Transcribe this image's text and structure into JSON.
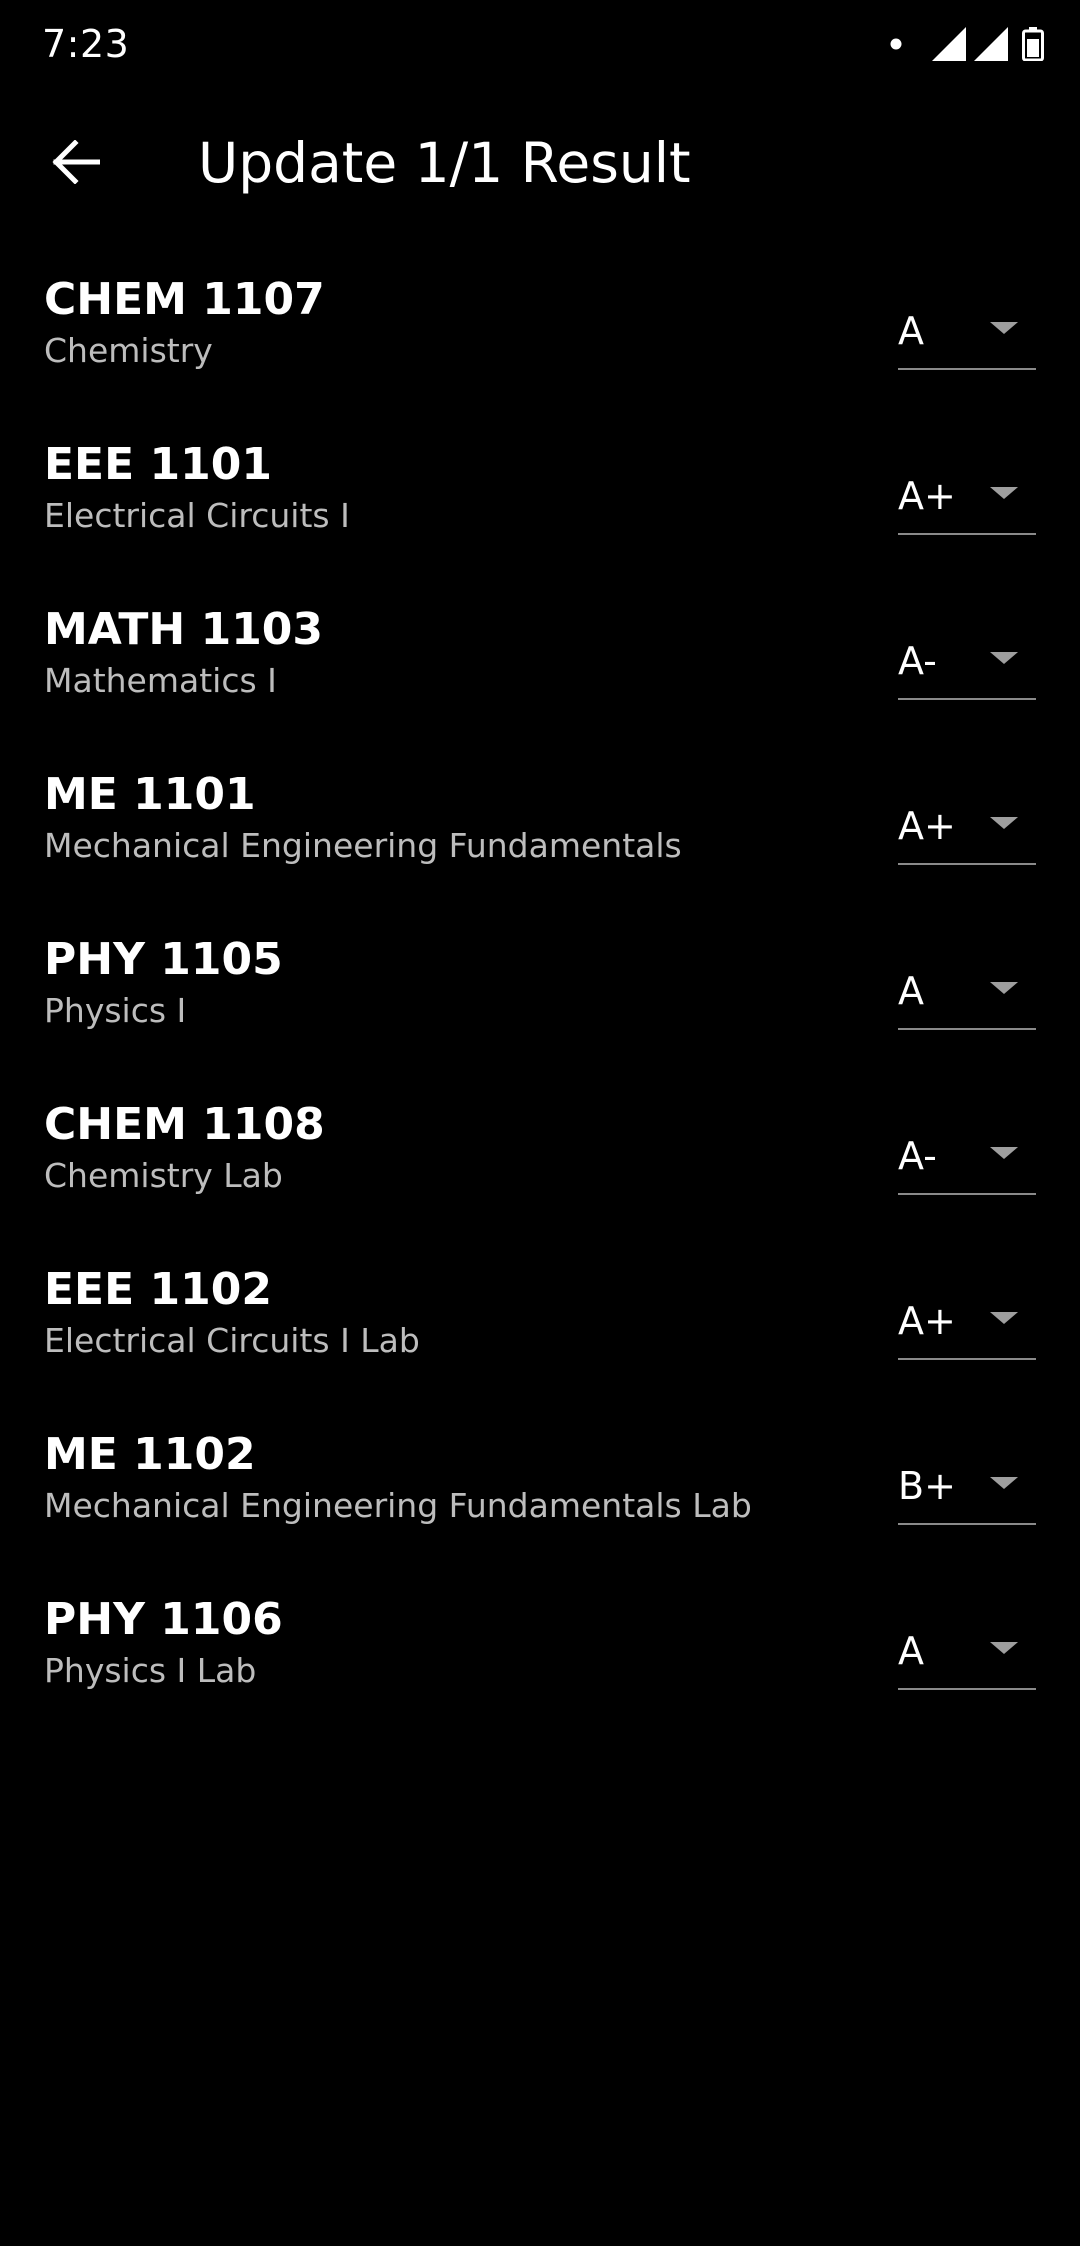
{
  "status_bar": {
    "time": "7:23"
  },
  "app_bar": {
    "title": "Update 1/1 Result"
  },
  "courses": [
    {
      "code": "CHEM 1107",
      "name": "Chemistry",
      "grade": "A"
    },
    {
      "code": "EEE 1101",
      "name": "Electrical Circuits I",
      "grade": "A+"
    },
    {
      "code": "MATH 1103",
      "name": "Mathematics I",
      "grade": "A-"
    },
    {
      "code": "ME 1101",
      "name": "Mechanical Engineering Fundamentals",
      "grade": "A+"
    },
    {
      "code": "PHY 1105",
      "name": "Physics I",
      "grade": "A"
    },
    {
      "code": "CHEM 1108",
      "name": "Chemistry Lab",
      "grade": "A-"
    },
    {
      "code": "EEE 1102",
      "name": "Electrical Circuits I Lab",
      "grade": "A+"
    },
    {
      "code": "ME 1102",
      "name": "Mechanical Engineering Fundamentals Lab",
      "grade": "B+"
    },
    {
      "code": "PHY 1106",
      "name": "Physics I Lab",
      "grade": "A"
    }
  ],
  "colors": {
    "background": "#000000",
    "text_primary": "#ffffff",
    "text_secondary": "#bdbdbd",
    "underline": "#8a8a8a"
  }
}
